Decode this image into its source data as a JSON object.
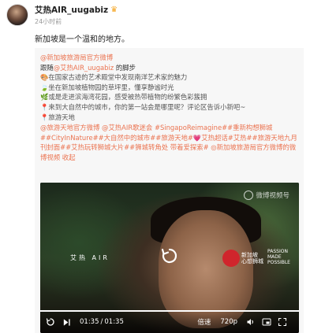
{
  "author": {
    "name": "艾热AIR_uugabiz",
    "time": "24小时前"
  },
  "post": {
    "text": "新加坡是一个温和的地方。"
  },
  "repost": {
    "source": "@新加坡旅游局官方微博",
    "line1_prefix": "跟随",
    "line1_mention": "@艾热AIR_uugabiz",
    "line1_suffix": " 的脚步",
    "lines": [
      "🎨在国家古迹的艺术殿堂中发现南洋艺术家的魅力",
      "🍃坐在新加坡植物园的草坪里，懂享静谧时光",
      "🌿或是走进滨海湾花园，感受被热带植物的纷繁色彩簇拥",
      "📍来到大自然中的城市，你的第一站会是哪里呢？评论区告诉小新吧~",
      "📍旅游天地"
    ],
    "tags": "@旅游天地官方微博 @艾热AIR歌迷会 #SingapoReimagine##重新构想狮城##CityInNature##大自然中的城市##旅游天地#💗艾热超话#艾热##旅游天地九月刊封面##艾热玩转狮城大片##狮城转角处 带着爱探索# ◎新加坡旅游局官方微博的微博视频 收起"
  },
  "video": {
    "watermark": "微博视频号",
    "brand_left": "艾热 AIR",
    "brand_sg1": "新加坡",
    "brand_sg2": "心想狮城",
    "brand_pass1": "PASSION",
    "brand_pass2": "MADE",
    "brand_pass3": "POSSIBLE",
    "time_current": "01:35",
    "time_total": "01:35",
    "speed": "倍速",
    "quality": "720p",
    "progress": 1.0
  }
}
